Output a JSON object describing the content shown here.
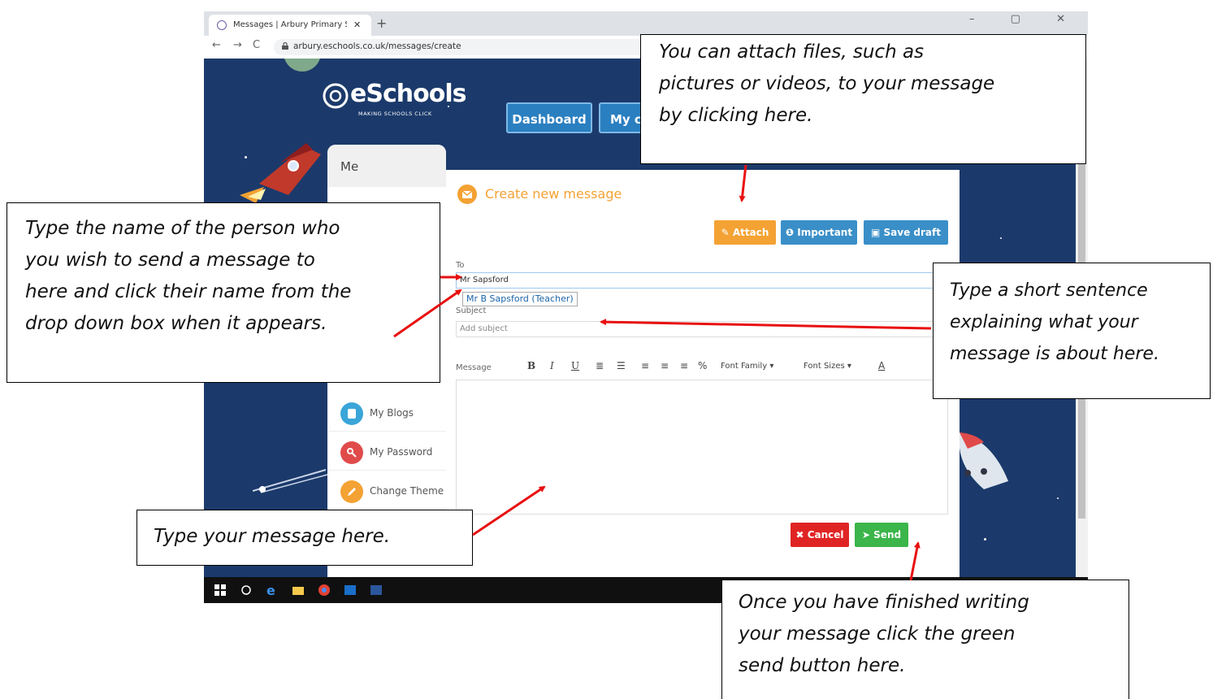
{
  "browser": {
    "tab_title": "Messages | Arbury Primary Schoo",
    "tab_close": "✕",
    "new_tab": "+",
    "url": "arbury.eschools.co.uk/messages/create",
    "window_controls": "–  ▢  ✕"
  },
  "site": {
    "logo_name": "eSchools",
    "logo_tagline": "MAKING SCHOOLS CLICK",
    "nav": {
      "dashboard": "Dashboard",
      "my": "My c"
    }
  },
  "sidebar": {
    "me": "Me",
    "items": [
      {
        "label": "My Blogs",
        "color": "#3aa5d8",
        "icon": "blog-icon"
      },
      {
        "label": "My Password",
        "color": "#e04a4a",
        "icon": "key-icon"
      },
      {
        "label": "Change Theme",
        "color": "#f4a233",
        "icon": "pencil-icon"
      }
    ]
  },
  "compose": {
    "title": "Create new message",
    "attach_label": "Attach",
    "important_label": "Important",
    "save_draft_label": "Save draft",
    "to_label": "To",
    "to_value": "Mr Sapsford",
    "suggestion": "Mr B Sapsford (Teacher)",
    "subject_label": "Subject",
    "subject_placeholder": "Add subject",
    "message_label": "Message",
    "toolbar": {
      "bold": "B",
      "italic": "I",
      "underline": "U",
      "font_family": "Font Family",
      "font_sizes": "Font Sizes",
      "font_color": "A"
    },
    "cancel_label": "Cancel",
    "send_label": "Send",
    "colors": {
      "orange": "#f4a233",
      "blue": "#3a8fc8",
      "red": "#e02424",
      "green": "#3cb54a"
    }
  },
  "callouts": {
    "attach": [
      "You can attach files, such as",
      "pictures or videos, to your message",
      "by clicking here."
    ],
    "to": [
      "Type the name of the person who",
      "you wish to send a message to",
      "here and click their name from the",
      "drop down box when it appears."
    ],
    "subject": [
      "Type a short sentence",
      "explaining what your",
      "message is about here."
    ],
    "message": [
      "Type your message here."
    ],
    "send": [
      "Once you have finished writing",
      "your message click the green",
      "send button here."
    ]
  }
}
